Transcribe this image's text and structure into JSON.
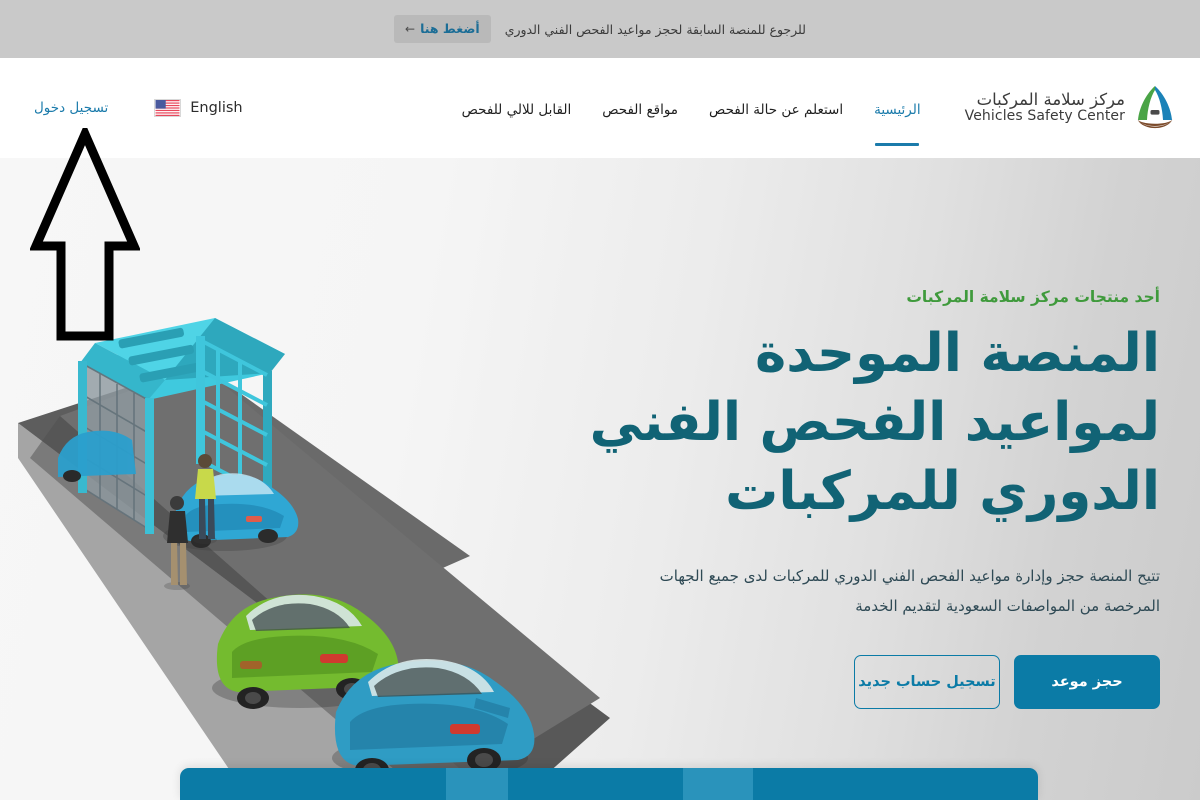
{
  "top_banner": {
    "text": "للرجوع للمنصة السابقة لحجز مواعيد الفحص الفني الدوري",
    "button_label": "أضغط هنا",
    "button_arrow": "←"
  },
  "header": {
    "logo": {
      "icon": "vehicles-safety-center-logo-icon",
      "arabic": "مركز سلامة المركبات",
      "english": "Vehicles Safety Center"
    },
    "nav_items": [
      {
        "label": "الرئيسية",
        "active": true
      },
      {
        "label": "استعلم عن حالة الفحص",
        "active": false
      },
      {
        "label": "مواقع الفحص",
        "active": false
      },
      {
        "label": "القابل للالي للفحص",
        "active": false
      }
    ],
    "language_switch": {
      "icon": "us-flag-icon",
      "label": "English"
    },
    "login_label": "تسجيل دخول"
  },
  "hero": {
    "eyebrow": "أحد منتجات مركز سلامة المركبات",
    "title": "المنصة الموحدة لمواعيد الفحص الفني الدوري للمركبات",
    "description": "تتيح المنصة حجز وإدارة مواعيد الفحص الفني الدوري للمركبات لدى جميع الجهات المرخصة من المواصفات السعودية لتقديم الخدمة",
    "primary_button": "حجز موعد",
    "secondary_button": "تسجيل حساب جديد",
    "illustration": "vehicle-inspection-station-illustration"
  },
  "annotation": {
    "arrow": "up-arrow-annotation pointing at login link"
  },
  "colors": {
    "primary_blue": "#0b7ba6",
    "heading_teal": "#116375",
    "accent_green": "#3f9a3c",
    "link_blue": "#1b7bab",
    "top_banner_gray": "#c9c9c9"
  }
}
